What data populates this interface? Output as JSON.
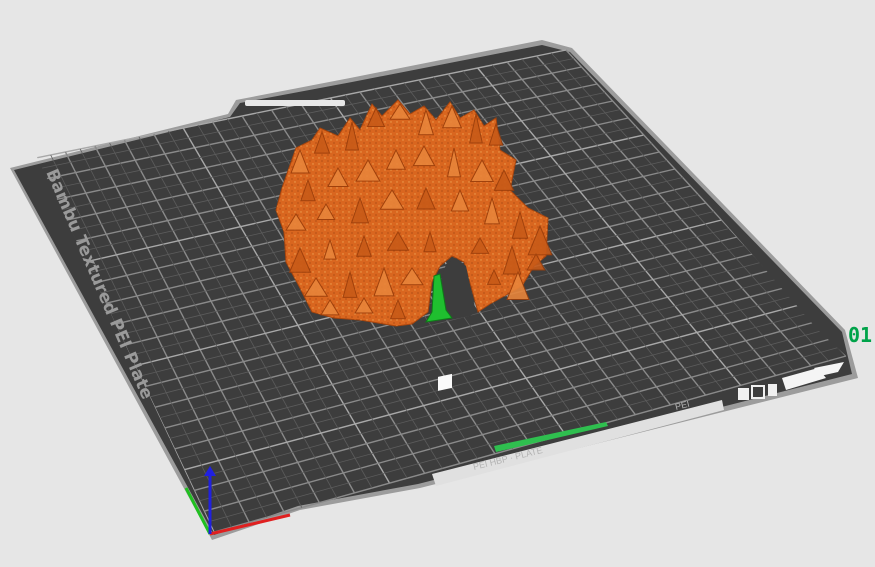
{
  "viewport": {
    "background": "#e6e6e6",
    "plate_name": "Bambu Textured PEI Plate",
    "plate_index": "01",
    "plate_color": "#3d3d3d",
    "grid_color": "#8a8a8a",
    "model_color": "#d9661f",
    "support_color": "#1fbf2f",
    "accent_color": "#00a34a",
    "bottom_strip_text": "PEI HBP · PLATE",
    "right_strip_text": "PEI"
  },
  "axes": {
    "x_color": "#e02020",
    "y_color": "#20c020",
    "z_color": "#2020e0"
  },
  "icons": [
    "filament-spool-icon",
    "plate-icon",
    "nozzle-icon",
    "qr-code-icon",
    "logo-icon"
  ]
}
